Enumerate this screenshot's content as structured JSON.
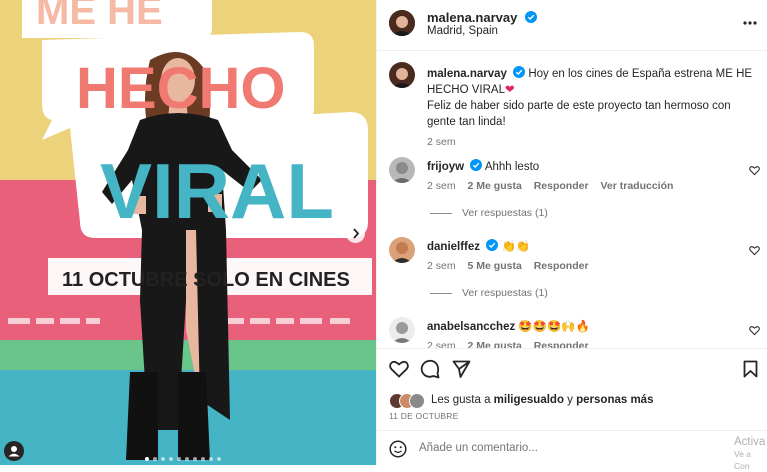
{
  "poster": {
    "line1": "ME HE",
    "line2": "HECHO",
    "line3": "VIRAL",
    "date_banner": "11 OCTUBRE SOLO EN CINES"
  },
  "post": {
    "username": "malena.narvay",
    "location": "Madrid, Spain",
    "caption_line1": "Hoy en los cines de España estrena ME HE",
    "caption_line2": "HECHO VIRAL",
    "caption_line3": "Feliz de haber sido parte de este proyecto tan hermoso con",
    "caption_line4": "gente tan linda!",
    "caption_time": "2 sem"
  },
  "comments": [
    {
      "username": "frijoyw",
      "text": "Ahhh lesto",
      "time": "2 sem",
      "likes": "2 Me gusta",
      "reply": "Responder",
      "translate": "Ver traducción",
      "view_replies": "Ver respuestas (1)"
    },
    {
      "username": "danielffez",
      "text": "👏👏",
      "time": "2 sem",
      "likes": "5 Me gusta",
      "reply": "Responder",
      "view_replies": "Ver respuestas (1)"
    },
    {
      "username": "anabelsancchez",
      "text": "🤩🤩🤩🙌🔥",
      "time": "2 sem",
      "likes": "2 Me gusta",
      "reply": "Responder"
    }
  ],
  "likes": {
    "prefix": "Les gusta a",
    "user": "miligesualdo",
    "middle": "y",
    "others": "personas más"
  },
  "post_date": "11 DE OCTUBRE",
  "add_comment_placeholder": "Añade un comentario...",
  "watermark": "Activa",
  "watermark2": "Ve a Con",
  "colors": {
    "verified": "#0095f6",
    "poster_yellow": "#ecd27a",
    "poster_pink": "#e8607a",
    "poster_green": "#69c58a",
    "poster_blue": "#45b4c4"
  }
}
